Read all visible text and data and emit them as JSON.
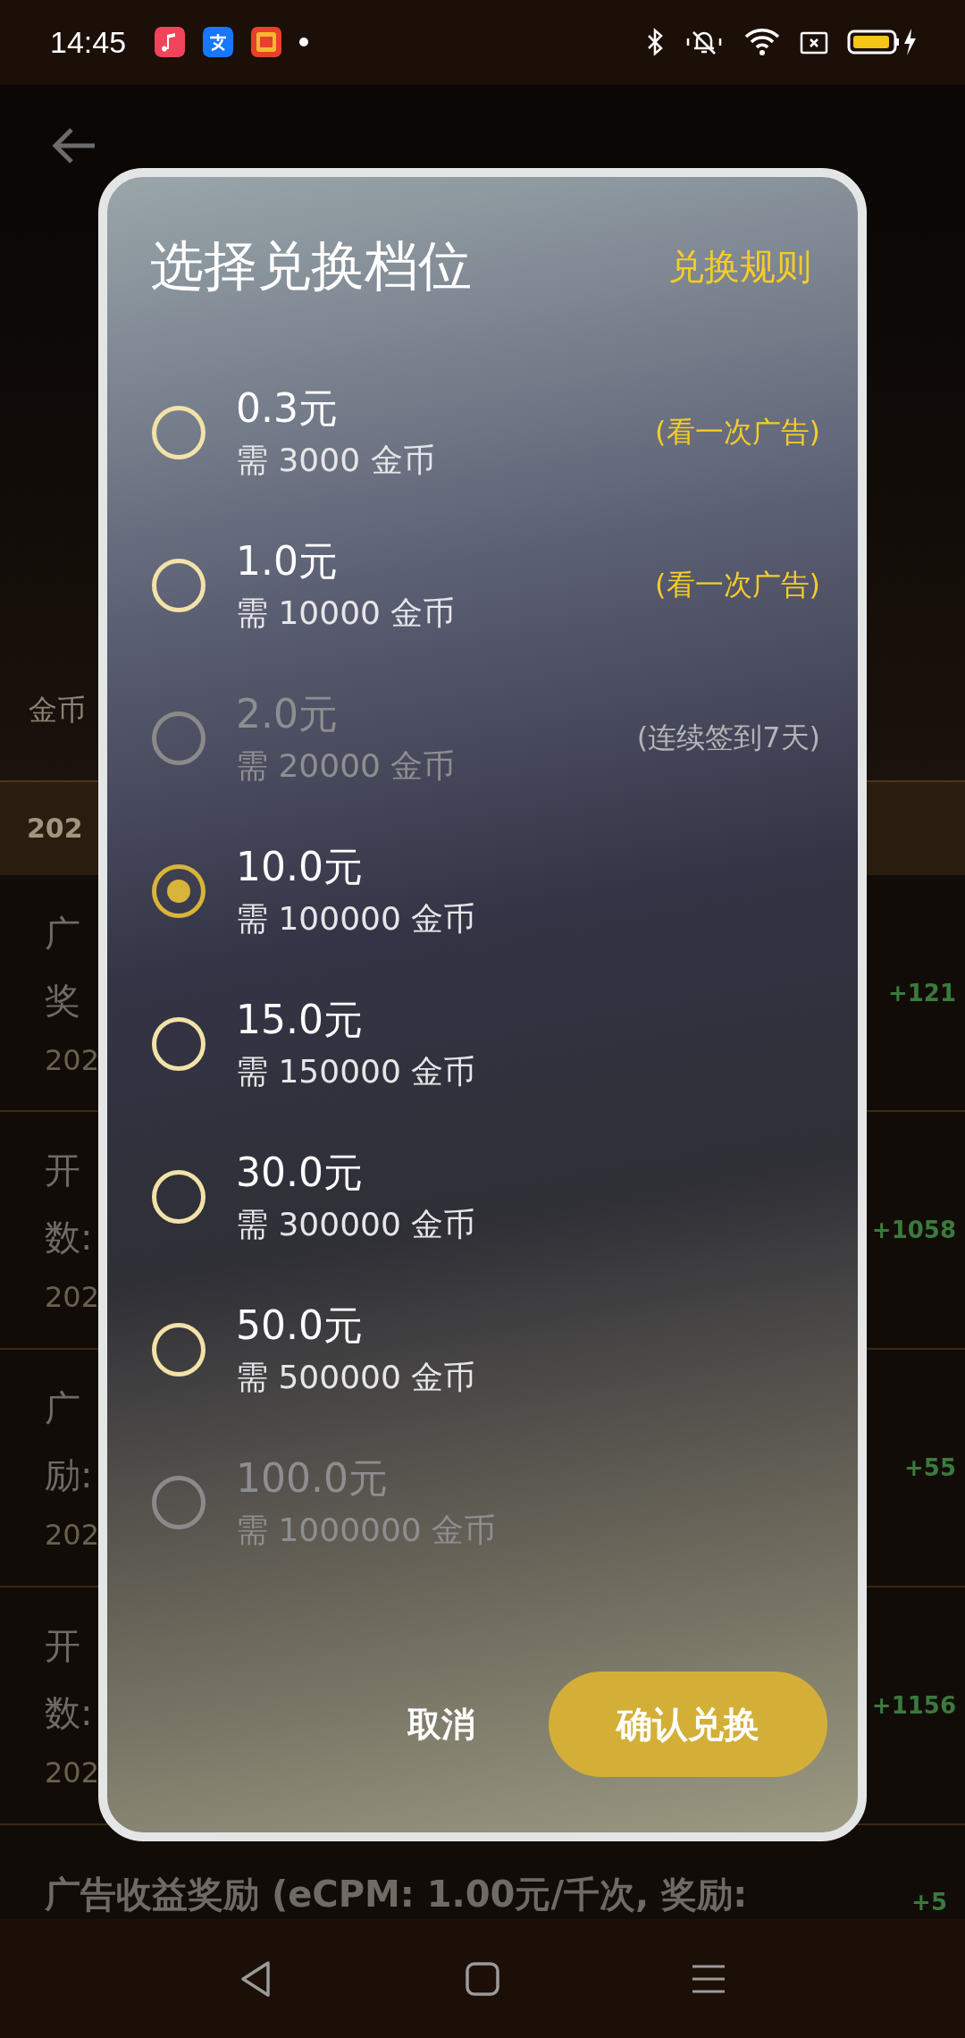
{
  "status_bar": {
    "time": "14:45"
  },
  "background": {
    "summary_label": "金币",
    "date_header": "202",
    "rows": [
      {
        "line1": "广",
        "line2": "奖",
        "date": "202",
        "amount": "+121"
      },
      {
        "line1": "开",
        "line2": "数:",
        "date": "202",
        "amount": "+1058"
      },
      {
        "line1": "广",
        "line2": "励:",
        "date": "202",
        "amount": "+55"
      },
      {
        "line1": "开",
        "line2": "数:",
        "date": "202",
        "amount": "+1156"
      }
    ],
    "last_row": {
      "text": "广告收益奖励 (eCPM: 1.00元/千次, 奖励:",
      "amount": "+5"
    }
  },
  "dialog": {
    "title": "选择兑换档位",
    "rules_link": "兑换规则",
    "options": [
      {
        "amount": "0.3元",
        "cost": "需 3000 金币",
        "note": "(看一次广告)",
        "selected": false,
        "disabled": false
      },
      {
        "amount": "1.0元",
        "cost": "需 10000 金币",
        "note": "(看一次广告)",
        "selected": false,
        "disabled": false
      },
      {
        "amount": "2.0元",
        "cost": "需 20000 金币",
        "note": "(连续签到7天)",
        "selected": false,
        "disabled": true
      },
      {
        "amount": "10.0元",
        "cost": "需 100000 金币",
        "selected": true,
        "disabled": false
      },
      {
        "amount": "15.0元",
        "cost": "需 150000 金币",
        "selected": false,
        "disabled": false
      },
      {
        "amount": "30.0元",
        "cost": "需 300000 金币",
        "selected": false,
        "disabled": false
      },
      {
        "amount": "50.0元",
        "cost": "需 500000 金币",
        "selected": false,
        "disabled": false
      },
      {
        "amount": "100.0元",
        "cost": "需 1000000 金币",
        "selected": false,
        "disabled": true
      }
    ],
    "cancel": "取消",
    "confirm": "确认兑换"
  }
}
